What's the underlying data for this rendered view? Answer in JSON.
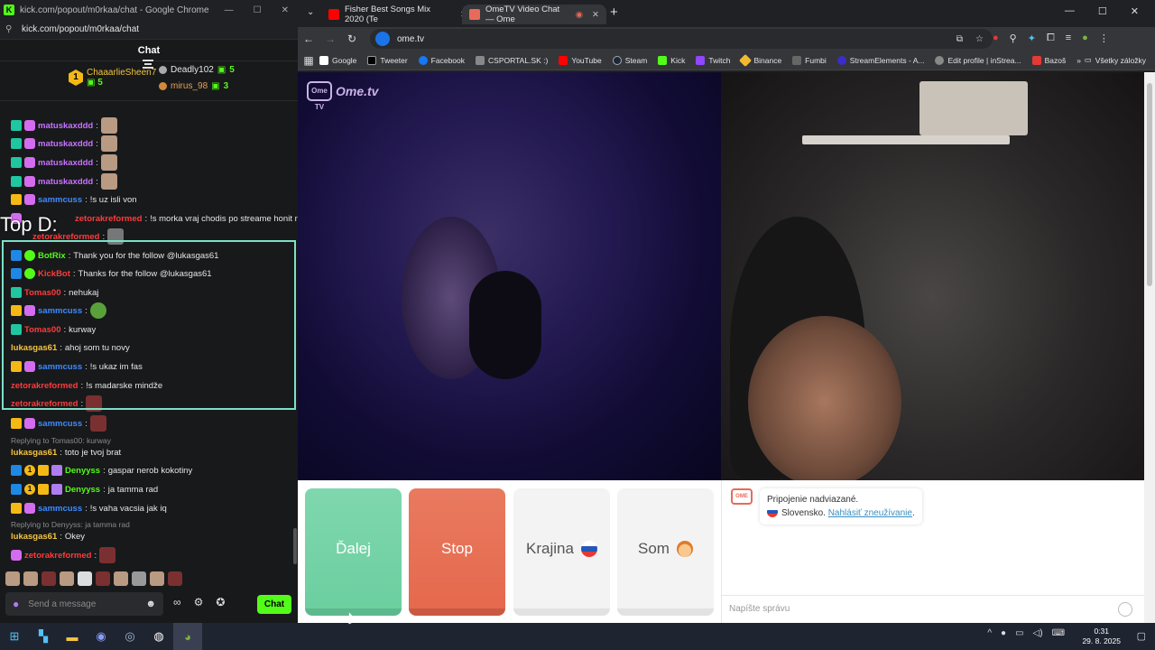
{
  "popout": {
    "title": "kick.com/popout/m0rkaa/chat - Google Chrome",
    "url": "kick.com/popout/m0rkaa/chat",
    "chat_header": "Chat",
    "gifters": [
      {
        "rank": "1",
        "name": "ChaaarlieSheen7",
        "count": "5"
      },
      {
        "name": "Deadly102",
        "count": "5"
      },
      {
        "name": "mirus_98",
        "count": "3"
      }
    ],
    "overlay_text": "Top D:",
    "messages": [
      {
        "user": "matuskaxddd",
        "sep": ":",
        "text": ""
      },
      {
        "user": "matuskaxddd",
        "sep": ":",
        "text": ""
      },
      {
        "user": "matuskaxddd",
        "sep": ":",
        "text": ""
      },
      {
        "user": "matuskaxddd",
        "sep": ":",
        "text": ""
      },
      {
        "user": "sammcuss",
        "sep": ":",
        "text": "!s uz isli von"
      },
      {
        "user": "zetorakreformed",
        "sep": ":",
        "text": "!s morka vraj chodis po streame honit na ome"
      },
      {
        "user": "zetorakreformed",
        "sep": ":",
        "text": ""
      },
      {
        "user": "BotRix",
        "sep": ":",
        "text": "Thank you for the follow @lukasgas61"
      },
      {
        "user": "KickBot",
        "sep": ":",
        "text": "Thanks for the follow @lukasgas61"
      },
      {
        "user": "Tomas00",
        "sep": ":",
        "text": "nehukaj"
      },
      {
        "user": "sammcuss",
        "sep": ":",
        "text": ""
      },
      {
        "user": "Tomas00",
        "sep": ":",
        "text": "kurway"
      },
      {
        "user": "lukasgas61",
        "sep": ":",
        "text": "ahoj som tu novy"
      },
      {
        "user": "sammcuss",
        "sep": ":",
        "text": "!s ukaz im fas"
      },
      {
        "user": "zetorakreformed",
        "sep": ":",
        "text": "!s madarske mindže"
      },
      {
        "user": "zetorakreformed",
        "sep": ":",
        "text": ""
      },
      {
        "user": "sammcuss",
        "sep": ":",
        "text": ""
      },
      {
        "reply": "Replying to Tomas00: kurway"
      },
      {
        "user": "lukasgas61",
        "sep": ":",
        "text": "toto je tvoj brat"
      },
      {
        "user": "Denyyss",
        "sep": ":",
        "text": "gaspar nerob kokotiny"
      },
      {
        "user": "Denyyss",
        "sep": ":",
        "text": "ja tamma rad"
      },
      {
        "user": "sammcuss",
        "sep": ":",
        "text": "!s vaha vacsia jak iq"
      },
      {
        "reply": "Replying to Denyyss: ja tamma rad"
      },
      {
        "user": "lukasgas61",
        "sep": ":",
        "text": "Okey"
      },
      {
        "user": "zetorakreformed",
        "sep": ":",
        "text": ""
      }
    ],
    "input_placeholder": "Send a message",
    "send_label": "Chat"
  },
  "browser": {
    "tabs": [
      {
        "title": "Fisher Best Songs Mix 2020 (Te",
        "color": "#ff0000"
      },
      {
        "title": "OmeTV Video Chat — Ome",
        "color": "#e86a5a"
      }
    ],
    "url": "ome.tv",
    "bookmarks": [
      "Google",
      "Tweeter",
      "Facebook",
      "CSPORTAL.SK :)",
      "YouTube",
      "Steam",
      "Kick",
      "Twitch",
      "Binance",
      "Fumbi",
      "StreamElements - A...",
      "Edit profile | inStrea...",
      "Bazoš"
    ],
    "all_bookmarks": "Všetky záložky"
  },
  "ometv": {
    "logo": "Ome.tv",
    "logo_box": "Ome TV",
    "buttons": {
      "next": "Ďalej",
      "stop": "Stop",
      "country": "Krajina",
      "gender": "Som"
    },
    "system_line1": "Pripojenie nadviazané.",
    "system_country": "Slovensko.",
    "system_report": "Nahlásiť zneužívanie",
    "system_end": ".",
    "message_placeholder": "Napíšte správu"
  },
  "taskbar": {
    "time": "0:31",
    "date": "29. 8. 2025"
  }
}
